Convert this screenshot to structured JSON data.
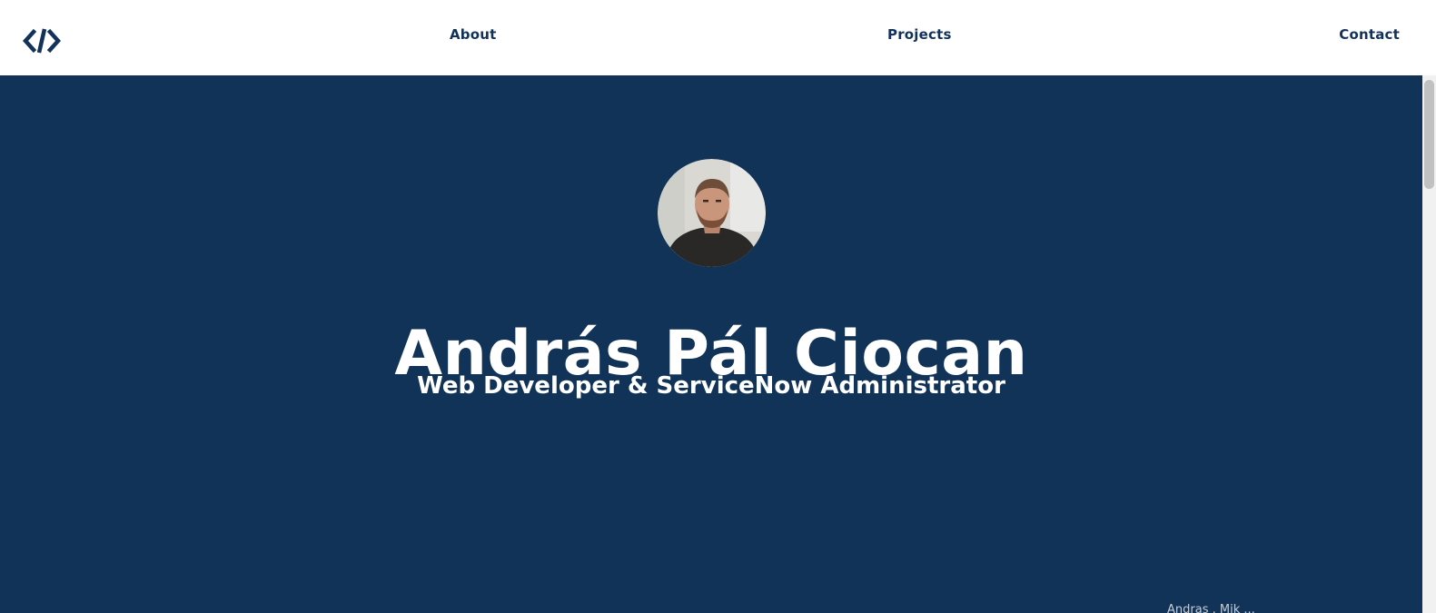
{
  "nav": {
    "logo_icon": "code-brackets-icon",
    "links": [
      {
        "label": "About"
      },
      {
        "label": "Projects"
      },
      {
        "label": "Contact"
      }
    ]
  },
  "hero": {
    "avatar_icon": "profile-photo",
    "name": "András Pál Ciocan",
    "subtitle": "Web Developer & ServiceNow Administrator",
    "corner_text": "Andras . Mik ..."
  },
  "colors": {
    "navy": "#123358",
    "nav_text": "#12325a",
    "white": "#ffffff"
  }
}
